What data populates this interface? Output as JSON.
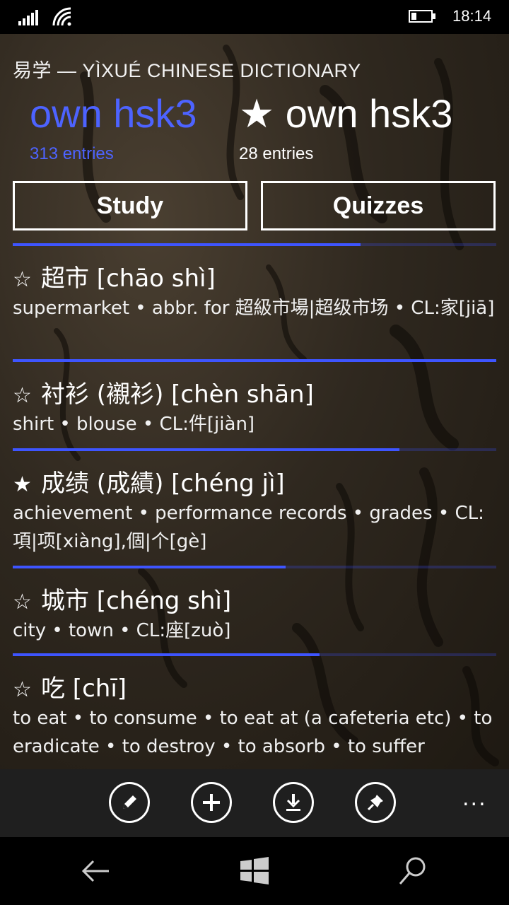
{
  "status_bar": {
    "time": "18:14",
    "battery_level": 0.25,
    "icons": [
      "signal-icon",
      "wifi-icon",
      "battery-icon"
    ]
  },
  "header": {
    "app_title": "易学 — YÌXUÉ CHINESE DICTIONARY",
    "pivots": [
      {
        "label": "own hsk3",
        "count": "313 entries",
        "active": true
      },
      {
        "label": "★ own hsk3",
        "count": "28 entries",
        "active": false
      }
    ]
  },
  "actions": {
    "study_label": "Study",
    "quizzes_label": "Quizzes"
  },
  "progress": {
    "list": 0.72
  },
  "entries": [
    {
      "star": "☆",
      "headword": "超市 [chāo shì]",
      "definition": "supermarket • abbr. for 超級市場|超级市场 • CL:家[jiā]",
      "progress": 1.0
    },
    {
      "star": "☆",
      "headword": "衬衫 (襯衫) [chèn shān]",
      "definition": "shirt • blouse • CL:件[jiàn]",
      "progress": 0.8
    },
    {
      "star": "★",
      "headword": "成绩 (成績) [chéng jì]",
      "definition": "achievement • performance records • grades • CL:項|项[xiàng],個|个[gè]",
      "progress": 0.565
    },
    {
      "star": "☆",
      "headword": "城市 [chéng shì]",
      "definition": "city • town • CL:座[zuò]",
      "progress": 0.634
    },
    {
      "star": "☆",
      "headword": "吃 [chī]",
      "definition": "to eat • to consume • to eat at (a cafeteria etc) • to eradicate • to destroy • to absorb • to suffer",
      "progress": 0
    }
  ],
  "app_bar": {
    "buttons": [
      "pencil-icon",
      "add-icon",
      "download-icon",
      "pin-icon"
    ],
    "more_label": "..."
  },
  "nav_bar": [
    "back-icon",
    "windows-icon",
    "search-icon"
  ],
  "colors": {
    "accent": "#3e55ff",
    "pivot_active": "#4d63ff",
    "app_bar": "#1f1f1f"
  }
}
